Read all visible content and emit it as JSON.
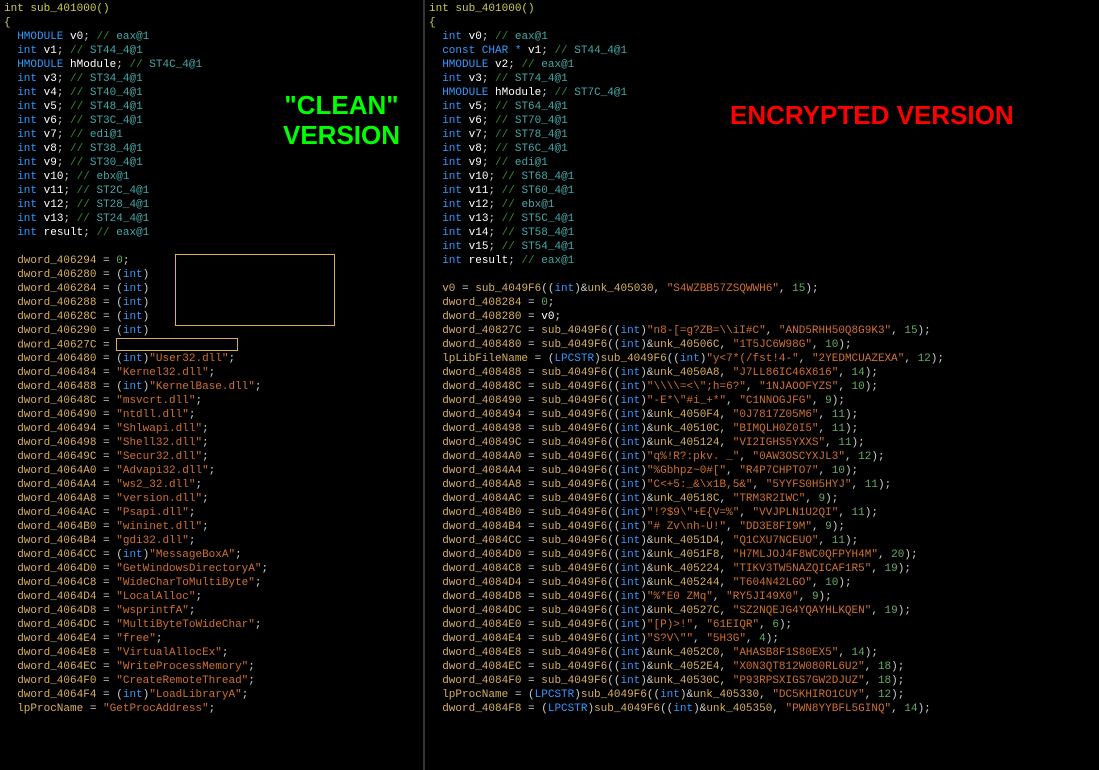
{
  "labels": {
    "clean": "\"CLEAN\"\nVERSION",
    "encrypted": "ENCRYPTED\nVERSION"
  },
  "left": {
    "signature": "int sub_401000()",
    "open_brace": "{",
    "decls": [
      {
        "t": "HMODULE",
        "n": "v0",
        "c": "eax@1"
      },
      {
        "t": "int",
        "n": "v1",
        "c": "ST44_4@1"
      },
      {
        "t": "HMODULE",
        "n": "hModule",
        "c": "ST4C_4@1"
      },
      {
        "t": "int",
        "n": "v3",
        "c": "ST34_4@1"
      },
      {
        "t": "int",
        "n": "v4",
        "c": "ST40_4@1"
      },
      {
        "t": "int",
        "n": "v5",
        "c": "ST48_4@1"
      },
      {
        "t": "int",
        "n": "v6",
        "c": "ST3C_4@1"
      },
      {
        "t": "int",
        "n": "v7",
        "c": "edi@1"
      },
      {
        "t": "int",
        "n": "v8",
        "c": "ST38_4@1"
      },
      {
        "t": "int",
        "n": "v9",
        "c": "ST30_4@1"
      },
      {
        "t": "int",
        "n": "v10",
        "c": "ebx@1"
      },
      {
        "t": "int",
        "n": "v11",
        "c": "ST2C_4@1"
      },
      {
        "t": "int",
        "n": "v12",
        "c": "ST28_4@1"
      },
      {
        "t": "int",
        "n": "v13",
        "c": "ST24_4@1"
      },
      {
        "t": "int",
        "n": "result",
        "c": "eax@1"
      }
    ],
    "body": [
      {
        "lhs": "dword_406294",
        "rhs_kind": "num",
        "rhs": "0"
      },
      {
        "lhs": "dword_406280",
        "rhs_kind": "castredact",
        "cast": "int",
        "redact": "big"
      },
      {
        "lhs": "dword_406284",
        "rhs_kind": "castredact",
        "cast": "int"
      },
      {
        "lhs": "dword_406288",
        "rhs_kind": "castredact",
        "cast": "int"
      },
      {
        "lhs": "dword_40628C",
        "rhs_kind": "castredact",
        "cast": "int"
      },
      {
        "lhs": "dword_406290",
        "rhs_kind": "castredact",
        "cast": "int"
      },
      {
        "lhs": "dword_40627C",
        "rhs_kind": "redactsmall"
      },
      {
        "lhs": "dword_406480",
        "rhs_kind": "caststr",
        "cast": "int",
        "str": "User32.dll"
      },
      {
        "lhs": "dword_406484",
        "rhs_kind": "str",
        "str": "Kernel32.dll"
      },
      {
        "lhs": "dword_406488",
        "rhs_kind": "caststr",
        "cast": "int",
        "str": "KernelBase.dll"
      },
      {
        "lhs": "dword_40648C",
        "rhs_kind": "str",
        "str": "msvcrt.dll"
      },
      {
        "lhs": "dword_406490",
        "rhs_kind": "str",
        "str": "ntdll.dll"
      },
      {
        "lhs": "dword_406494",
        "rhs_kind": "str",
        "str": "Shlwapi.dll"
      },
      {
        "lhs": "dword_406498",
        "rhs_kind": "str",
        "str": "Shell32.dll"
      },
      {
        "lhs": "dword_40649C",
        "rhs_kind": "str",
        "str": "Secur32.dll"
      },
      {
        "lhs": "dword_4064A0",
        "rhs_kind": "str",
        "str": "Advapi32.dll"
      },
      {
        "lhs": "dword_4064A4",
        "rhs_kind": "str",
        "str": "ws2_32.dll"
      },
      {
        "lhs": "dword_4064A8",
        "rhs_kind": "str",
        "str": "version.dll"
      },
      {
        "lhs": "dword_4064AC",
        "rhs_kind": "str",
        "str": "Psapi.dll"
      },
      {
        "lhs": "dword_4064B0",
        "rhs_kind": "str",
        "str": "wininet.dll"
      },
      {
        "lhs": "dword_4064B4",
        "rhs_kind": "str",
        "str": "gdi32.dll"
      },
      {
        "lhs": "dword_4064CC",
        "rhs_kind": "caststr",
        "cast": "int",
        "str": "MessageBoxA"
      },
      {
        "lhs": "dword_4064D0",
        "rhs_kind": "str",
        "str": "GetWindowsDirectoryA"
      },
      {
        "lhs": "dword_4064C8",
        "rhs_kind": "str",
        "str": "WideCharToMultiByte"
      },
      {
        "lhs": "dword_4064D4",
        "rhs_kind": "str",
        "str": "LocalAlloc"
      },
      {
        "lhs": "dword_4064D8",
        "rhs_kind": "str",
        "str": "wsprintfA"
      },
      {
        "lhs": "dword_4064DC",
        "rhs_kind": "str",
        "str": "MultiByteToWideChar"
      },
      {
        "lhs": "dword_4064E4",
        "rhs_kind": "str",
        "str": "free"
      },
      {
        "lhs": "dword_4064E8",
        "rhs_kind": "str",
        "str": "VirtualAllocEx"
      },
      {
        "lhs": "dword_4064EC",
        "rhs_kind": "str",
        "str": "WriteProcessMemory"
      },
      {
        "lhs": "dword_4064F0",
        "rhs_kind": "str",
        "str": "CreateRemoteThread"
      },
      {
        "lhs": "dword_4064F4",
        "rhs_kind": "caststr",
        "cast": "int",
        "str": "LoadLibraryA"
      },
      {
        "lhs": "lpProcName",
        "rhs_kind": "str",
        "str": "GetProcAddress"
      }
    ]
  },
  "right": {
    "signature": "int sub_401000()",
    "open_brace": "{",
    "decls": [
      {
        "t": "int",
        "n": "v0",
        "c": "eax@1"
      },
      {
        "t": "const CHAR *",
        "n": "v1",
        "c": "ST44_4@1"
      },
      {
        "t": "HMODULE",
        "n": "v2",
        "c": "eax@1"
      },
      {
        "t": "int",
        "n": "v3",
        "c": "ST74_4@1"
      },
      {
        "t": "HMODULE",
        "n": "hModule",
        "c": "ST7C_4@1"
      },
      {
        "t": "int",
        "n": "v5",
        "c": "ST64_4@1"
      },
      {
        "t": "int",
        "n": "v6",
        "c": "ST70_4@1"
      },
      {
        "t": "int",
        "n": "v7",
        "c": "ST78_4@1"
      },
      {
        "t": "int",
        "n": "v8",
        "c": "ST6C_4@1"
      },
      {
        "t": "int",
        "n": "v9",
        "c": "edi@1"
      },
      {
        "t": "int",
        "n": "v10",
        "c": "ST68_4@1"
      },
      {
        "t": "int",
        "n": "v11",
        "c": "ST60_4@1"
      },
      {
        "t": "int",
        "n": "v12",
        "c": "ebx@1"
      },
      {
        "t": "int",
        "n": "v13",
        "c": "ST5C_4@1"
      },
      {
        "t": "int",
        "n": "v14",
        "c": "ST58_4@1"
      },
      {
        "t": "int",
        "n": "v15",
        "c": "ST54_4@1"
      },
      {
        "t": "int",
        "n": "result",
        "c": "eax@1"
      }
    ],
    "body": [
      {
        "lhs": "v0",
        "rhs_kind": "call",
        "func": "sub_4049F6",
        "arg_kind": "unk",
        "arg": "unk_405030",
        "key": "S4WZBB57ZSQWWH6",
        "n": "15"
      },
      {
        "lhs": "dword_408284",
        "rhs_kind": "num",
        "rhs": "0"
      },
      {
        "lhs": "dword_408280",
        "rhs_kind": "id",
        "rhs": "v0"
      },
      {
        "lhs": "dword_40827C",
        "rhs_kind": "call",
        "func": "sub_4049F6",
        "arg_kind": "str",
        "arg": "n8-[=g?ZB=\\\\iI#C",
        "key": "AND5RHH50Q8G9K3",
        "n": "15"
      },
      {
        "lhs": "dword_408480",
        "rhs_kind": "call",
        "func": "sub_4049F6",
        "arg_kind": "unk",
        "arg": "unk_40506C",
        "key": "1T5JC6W98G",
        "n": "10"
      },
      {
        "lhs": "lpLibFileName",
        "rhs_kind": "castcall",
        "cast": "LPCSTR",
        "func": "sub_4049F6",
        "arg_kind": "str",
        "arg": "y<7*(/fst!4-",
        "key": "2YEDMCUAZEXA",
        "n": "12"
      },
      {
        "lhs": "dword_408488",
        "rhs_kind": "call",
        "func": "sub_4049F6",
        "arg_kind": "unk",
        "arg": "unk_4050A8",
        "key": "J7LL86IC46X616",
        "n": "14"
      },
      {
        "lhs": "dword_40848C",
        "rhs_kind": "call",
        "func": "sub_4049F6",
        "arg_kind": "str",
        "arg": "\\\\\\\\=<\\\";h=6?",
        "key": "1NJAOOFYZS",
        "n": "10"
      },
      {
        "lhs": "dword_408490",
        "rhs_kind": "call",
        "func": "sub_4049F6",
        "arg_kind": "str",
        "arg": "-E*\\\"#i_+*",
        "key": "C1NNOGJFG",
        "n": "9"
      },
      {
        "lhs": "dword_408494",
        "rhs_kind": "call",
        "func": "sub_4049F6",
        "arg_kind": "unk",
        "arg": "unk_4050F4",
        "key": "0J7817Z05M6",
        "n": "11"
      },
      {
        "lhs": "dword_408498",
        "rhs_kind": "call",
        "func": "sub_4049F6",
        "arg_kind": "unk",
        "arg": "unk_40510C",
        "key": "BIMQLH0Z0I5",
        "n": "11"
      },
      {
        "lhs": "dword_40849C",
        "rhs_kind": "call",
        "func": "sub_4049F6",
        "arg_kind": "unk",
        "arg": "unk_405124",
        "key": "VI2IGHS5YXXS",
        "n": "11"
      },
      {
        "lhs": "dword_4084A0",
        "rhs_kind": "call",
        "func": "sub_4049F6",
        "arg_kind": "str",
        "arg": "q%!R?:pkv. _",
        "key": "0AW3OSCYXJL3",
        "n": "12"
      },
      {
        "lhs": "dword_4084A4",
        "rhs_kind": "call",
        "func": "sub_4049F6",
        "arg_kind": "str",
        "arg": "%Gbhpz~0#[",
        "key": "R4P7CHPTO7",
        "n": "10"
      },
      {
        "lhs": "dword_4084A8",
        "rhs_kind": "call",
        "func": "sub_4049F6",
        "arg_kind": "str",
        "arg": "C<+5:_&\\x1B,5&",
        "key": "5YYFS0H5HYJ",
        "n": "11"
      },
      {
        "lhs": "dword_4084AC",
        "rhs_kind": "call",
        "func": "sub_4049F6",
        "arg_kind": "unk",
        "arg": "unk_40518C",
        "key": "TRM3R2IWC",
        "n": "9"
      },
      {
        "lhs": "dword_4084B0",
        "rhs_kind": "call",
        "func": "sub_4049F6",
        "arg_kind": "str",
        "arg": "!?$9\\\"+E{V=%",
        "key": "VVJPLN1U2QI",
        "n": "11"
      },
      {
        "lhs": "dword_4084B4",
        "rhs_kind": "call",
        "func": "sub_4049F6",
        "arg_kind": "str",
        "arg": "# Zv\\nh-U!",
        "key": "DD3E8FI9M",
        "n": "9"
      },
      {
        "lhs": "dword_4084CC",
        "rhs_kind": "call",
        "func": "sub_4049F6",
        "arg_kind": "unk",
        "arg": "unk_4051D4",
        "key": "Q1CXU7NCEUO",
        "n": "11"
      },
      {
        "lhs": "dword_4084D0",
        "rhs_kind": "call",
        "func": "sub_4049F6",
        "arg_kind": "unk",
        "arg": "unk_4051F8",
        "key": "H7MLJOJ4F8WC0QFPYH4M",
        "n": "20"
      },
      {
        "lhs": "dword_4084C8",
        "rhs_kind": "call",
        "func": "sub_4049F6",
        "arg_kind": "unk",
        "arg": "unk_405224",
        "key": "TIKV3TW5NAZQICAF1R5",
        "n": "19"
      },
      {
        "lhs": "dword_4084D4",
        "rhs_kind": "call",
        "func": "sub_4049F6",
        "arg_kind": "unk",
        "arg": "unk_405244",
        "key": "T604N42LGO",
        "n": "10"
      },
      {
        "lhs": "dword_4084D8",
        "rhs_kind": "call",
        "func": "sub_4049F6",
        "arg_kind": "str",
        "arg": "%*E0 ZMq",
        "key": "RY5JI49X0",
        "n": "9"
      },
      {
        "lhs": "dword_4084DC",
        "rhs_kind": "call",
        "func": "sub_4049F6",
        "arg_kind": "unk",
        "arg": "unk_40527C",
        "key": "SZ2NQEJG4YQAYHLKQEN",
        "n": "19"
      },
      {
        "lhs": "dword_4084E0",
        "rhs_kind": "call",
        "func": "sub_4049F6",
        "arg_kind": "str",
        "arg": "[P)>!",
        "key": "61EIQR",
        "n": "6"
      },
      {
        "lhs": "dword_4084E4",
        "rhs_kind": "call",
        "func": "sub_4049F6",
        "arg_kind": "str",
        "arg": "S?V\\\"",
        "key": "5H3G",
        "n": "4"
      },
      {
        "lhs": "dword_4084E8",
        "rhs_kind": "call",
        "func": "sub_4049F6",
        "arg_kind": "unk",
        "arg": "unk_4052C0",
        "key": "AHASB8F1S80EX5",
        "n": "14"
      },
      {
        "lhs": "dword_4084EC",
        "rhs_kind": "call",
        "func": "sub_4049F6",
        "arg_kind": "unk",
        "arg": "unk_4052E4",
        "key": "X0N3QT812W080RL6U2",
        "n": "18"
      },
      {
        "lhs": "dword_4084F0",
        "rhs_kind": "call",
        "func": "sub_4049F6",
        "arg_kind": "unk",
        "arg": "unk_40530C",
        "key": "P93RPSXIGS7GW2DJUZ",
        "n": "18"
      },
      {
        "lhs": "lpProcName",
        "rhs_kind": "castcall",
        "cast": "LPCSTR",
        "func": "sub_4049F6",
        "arg_kind": "unk",
        "arg": "unk_405330",
        "key": "DC5KHIRO1CUY",
        "n": "12"
      },
      {
        "lhs": "dword_4084F8",
        "rhs_kind": "castcall",
        "cast": "LPCSTR",
        "func": "sub_4049F6",
        "arg_kind": "unk",
        "arg": "unk_405350",
        "key": "PWN8YYBFL5GINQ",
        "n": "14"
      }
    ]
  }
}
